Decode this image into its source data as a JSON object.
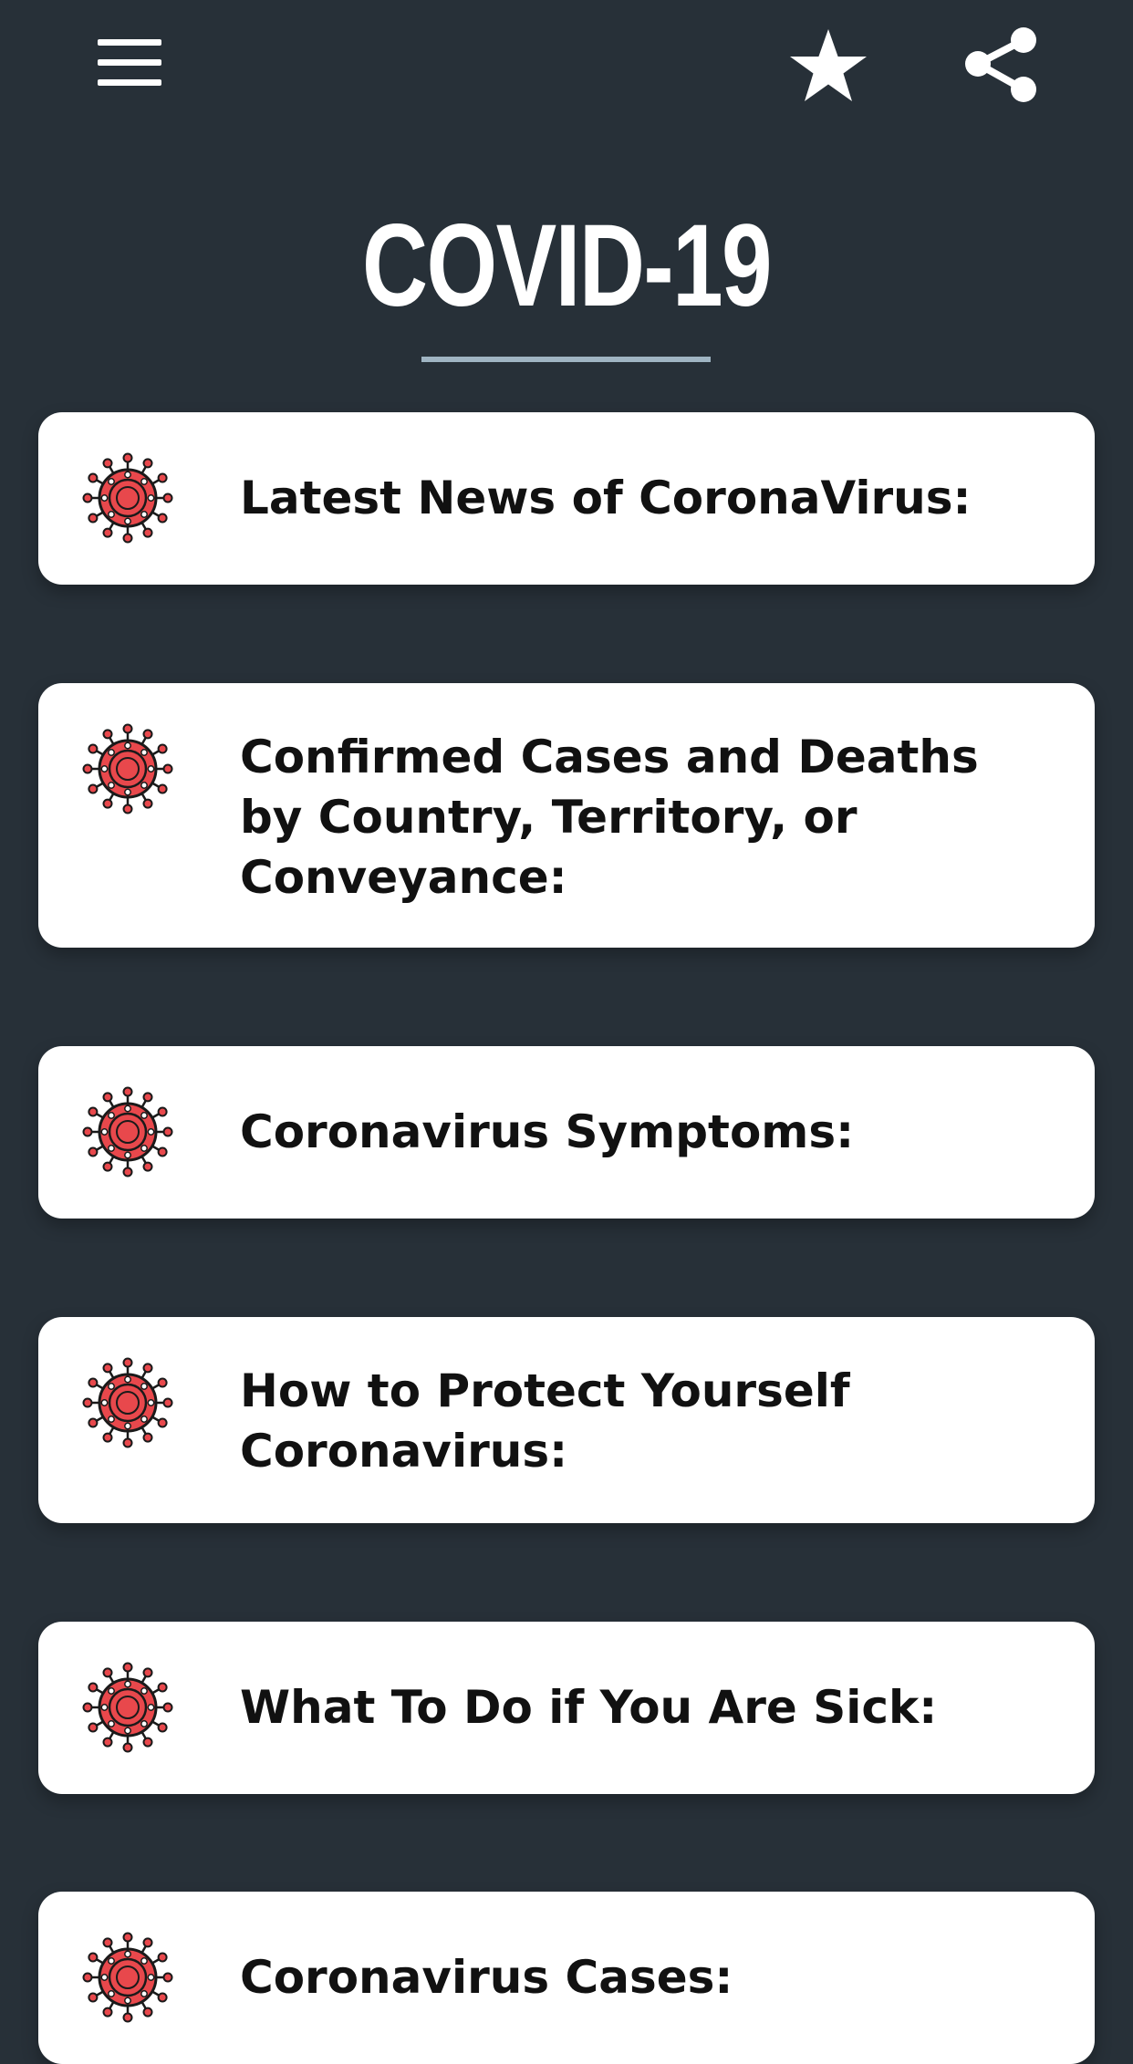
{
  "header": {
    "menu_icon": "hamburger-menu-icon",
    "favorite_icon": "star-icon",
    "share_icon": "share-icon"
  },
  "title": "COVID-19",
  "colors": {
    "background": "#273038",
    "card": "#ffffff",
    "accent_underline": "#9fb4c2",
    "virus_red": "#e8484c"
  },
  "items": [
    {
      "label": "Latest News of CoronaVirus:",
      "icon": "virus-icon"
    },
    {
      "label": "Confirmed Cases and Deaths by Country, Territory, or Conveyance:",
      "icon": "virus-icon"
    },
    {
      "label": "Coronavirus Symptoms:",
      "icon": "virus-icon"
    },
    {
      "label": "How to Protect Yourself Coronavirus:",
      "icon": "virus-icon"
    },
    {
      "label": "What To Do if You Are Sick:",
      "icon": "virus-icon"
    },
    {
      "label": "Coronavirus Cases:",
      "icon": "virus-icon"
    }
  ]
}
